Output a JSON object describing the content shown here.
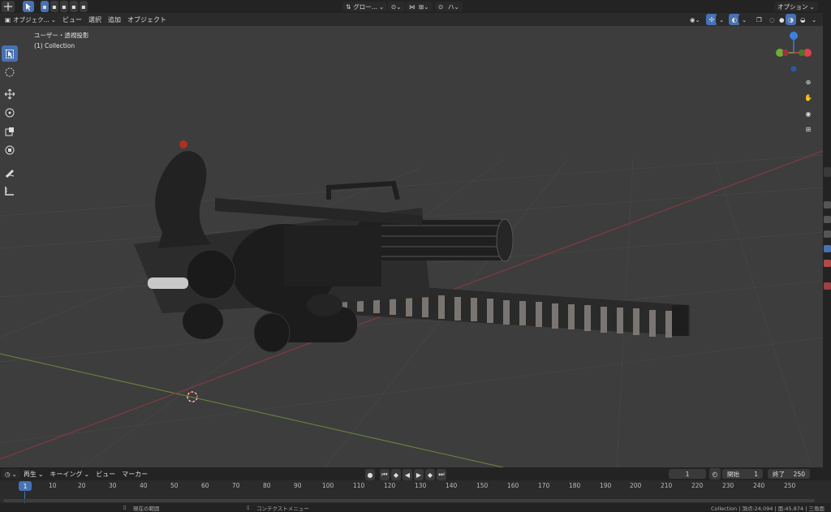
{
  "topbar": {
    "transform_orientation": "グロー...",
    "options_label": "オプション"
  },
  "header": {
    "mode_label": "オブジェク...",
    "menu": [
      "ビュー",
      "選択",
      "追加",
      "オブジェクト"
    ]
  },
  "viewport": {
    "view_name": "ユーザー・透視投影",
    "collection_label": "(1) Collection",
    "gizmo_axes": {
      "x": "X",
      "y": "Y",
      "z": "Z"
    }
  },
  "timeline": {
    "playback_label": "再生",
    "keying_label": "キーイング",
    "view_label": "ビュー",
    "marker_label": "マーカー",
    "current_frame": "1",
    "start_label": "開始",
    "start_value": "1",
    "end_label": "終了",
    "end_value": "250",
    "ruler_current": "1",
    "ruler_ticks": [
      "10",
      "20",
      "30",
      "40",
      "50",
      "60",
      "70",
      "80",
      "90",
      "100",
      "110",
      "120",
      "130",
      "140",
      "150",
      "160",
      "170",
      "180",
      "190",
      "200",
      "210",
      "220",
      "230",
      "240",
      "250"
    ]
  },
  "statusbar": {
    "left_hint": "現在の範囲",
    "mid_hint": "コンテクストメニュー",
    "right_info": "Collection | 頂点:24,094 | 面:45,874 | 三角面"
  },
  "colors": {
    "accent": "#4772b3",
    "viewport_bg": "#3d3d3d",
    "axis_x": "#e04050",
    "axis_y": "#70b030",
    "axis_z": "#3a80e0"
  }
}
